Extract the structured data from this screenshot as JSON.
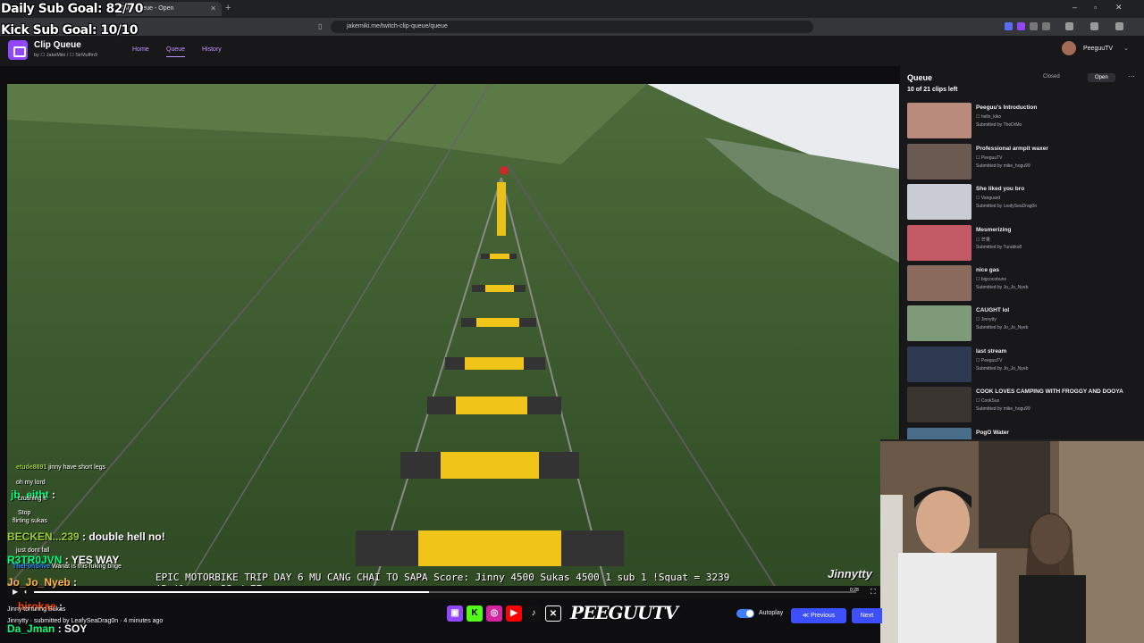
{
  "overlay": {
    "daily_goal": "Daily Sub Goal: 82/70",
    "kick_goal": "Kick Sub Goal: 10/10"
  },
  "browser": {
    "tab_title": "Clip Queue - Open",
    "url": "jakemiki.me/twitch-clip-queue/queue"
  },
  "app": {
    "title": "Clip Queue",
    "subtitle": "by ☐ JakeMiki / ☐ SirMuffin9",
    "nav": {
      "home": "Home",
      "queue": "Queue",
      "history": "History"
    },
    "user": "PeeguuTV"
  },
  "player": {
    "info_overlay": "EPIC MOTORBIKE TRIP DAY 6 MU CANG CHAI TO SAPA    Score: Jinny 4500 Sukas 4500    1 sub 1 !Squat = 3239  !Daily sub 33 / 77",
    "clip_creator": "Jinnytty",
    "time": "0:28",
    "progress": 0.48
  },
  "queue": {
    "title": "Queue",
    "count": "10 of 21 clips left",
    "closed_label": "Closed",
    "open_label": "Open",
    "items": [
      {
        "title": "Peeguu's Introduction",
        "channel": "hello_kiko",
        "submitted": "Submitted by TheDrMo",
        "thumb_color": "#b98b7c"
      },
      {
        "title": "Professional armpit waxer",
        "channel": "PeeguuTV",
        "submitted": "Submitted by mike_hogu99",
        "thumb_color": "#6b5a52"
      },
      {
        "title": "She liked you bro",
        "channel": "Vanguard",
        "submitted": "Submitted by LeafySeaDrag0n",
        "thumb_color": "#c9ccd3"
      },
      {
        "title": "Mesmerizing",
        "channel": "芒果",
        "submitted": "Submitted by Turakko8",
        "thumb_color": "#c25a66"
      },
      {
        "title": "nice gas",
        "channel": "bigcocobuns",
        "submitted": "Submitted by Jo_Jo_Nyeb",
        "thumb_color": "#8a6a5c"
      },
      {
        "title": "CAUGHT lol",
        "channel": "Jinnytty",
        "submitted": "Submitted by Jo_Jo_Nyeb",
        "thumb_color": "#7e9a78"
      },
      {
        "title": "last stream",
        "channel": "PeeguuTV",
        "submitted": "Submitted by Jo_Jo_Nyeb",
        "thumb_color": "#2d3a52"
      },
      {
        "title": "COOK LOVES CAMPING WITH FROGGY AND DOOYA",
        "channel": "CookSux",
        "submitted": "Submitted by mike_hogu99",
        "thumb_color": "#3a3530"
      },
      {
        "title": "PogO Water",
        "channel": "",
        "submitted": "",
        "thumb_color": "#4a6d8a"
      }
    ]
  },
  "chat": [
    {
      "user": "etude8891",
      "msg": "jinny have short legs"
    },
    {
      "user": "",
      "msg": "oh my lord"
    },
    {
      "user": "jb_eitht",
      "msg": ":"
    },
    {
      "user": "",
      "msg": "crushing it"
    },
    {
      "user": "",
      "msg": "Stop"
    },
    {
      "user": "",
      "msg": "flirting sukas"
    },
    {
      "user": "BECKEN...239",
      "msg": ": double hell no!"
    },
    {
      "user": "",
      "msg": "just dont fall"
    },
    {
      "user": "R3TR0JVN",
      "msg": ": YES WAY"
    },
    {
      "user": "TheFonShve",
      "msg": "Wanat is this fuking brige"
    },
    {
      "user": "Jo_Jo_Nyeb",
      "msg": ":"
    },
    {
      "user": "hirokae",
      "msg": ":"
    },
    {
      "user": "",
      "msg": "Jinny torturing Sukas"
    },
    {
      "user": "",
      "msg": "Jinnytty · submitted by LeafySeaDrag0n · 4 minutes ago"
    },
    {
      "user": "Da_Jman",
      "msg": ": SOY"
    }
  ],
  "controls": {
    "autoplay": "Autoplay",
    "previous": "Previous",
    "next": "Next",
    "brand": "PEEGUUTV"
  }
}
